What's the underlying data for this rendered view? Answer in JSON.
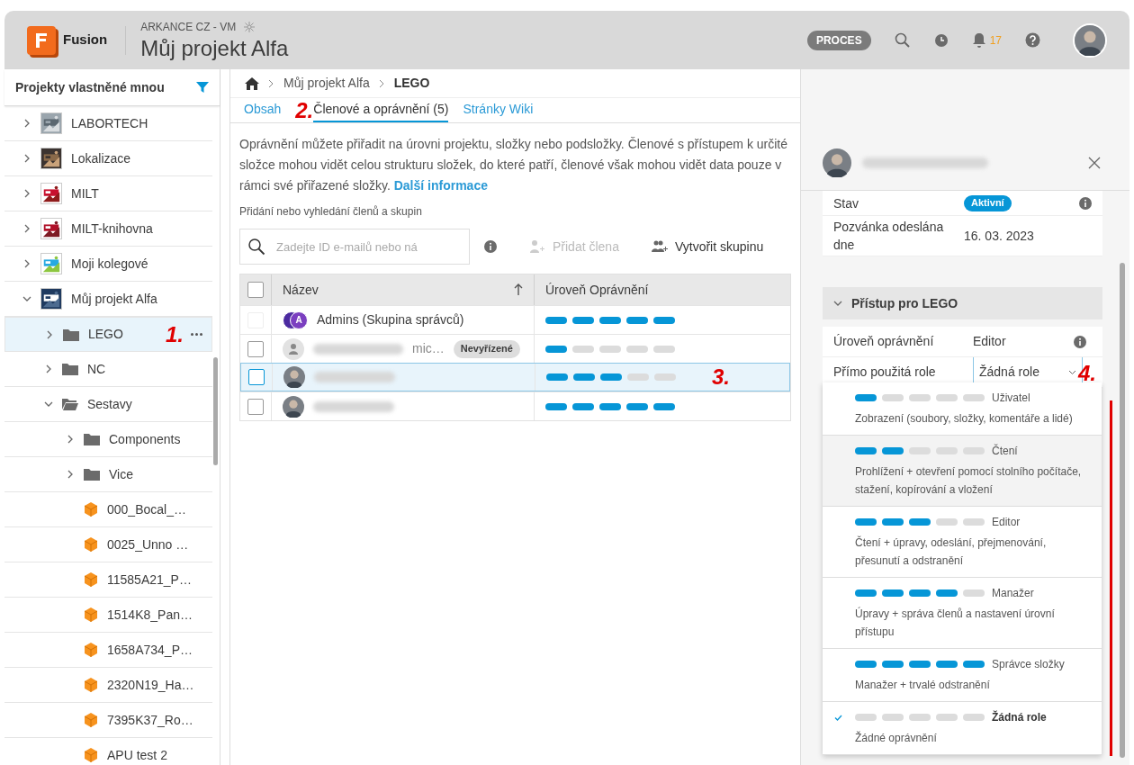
{
  "header": {
    "brand": "Fusion",
    "hub": "ARKANCE CZ - VM",
    "project_title": "Můj projekt Alfa",
    "process_badge": "PROCES",
    "notification_count": "17"
  },
  "sidebar": {
    "title": "Projekty vlastněné mnou",
    "tree": [
      {
        "kind": "project",
        "label": "LABORTECH",
        "expanded": false,
        "selected": false
      },
      {
        "kind": "project",
        "label": "Lokalizace",
        "expanded": false,
        "selected": false
      },
      {
        "kind": "project",
        "label": "MILT",
        "expanded": false,
        "selected": false
      },
      {
        "kind": "project",
        "label": "MILT-knihovna",
        "expanded": false,
        "selected": false
      },
      {
        "kind": "project",
        "label": "Moji kolegové",
        "expanded": false,
        "selected": false
      },
      {
        "kind": "project",
        "label": "Můj projekt Alfa",
        "expanded": true,
        "selected": false,
        "children": [
          {
            "kind": "folder",
            "label": "LEGO",
            "expanded": false,
            "selected": true
          },
          {
            "kind": "folder",
            "label": "NC",
            "expanded": false,
            "selected": false
          },
          {
            "kind": "folder",
            "label": "Sestavy",
            "expanded": true,
            "selected": false,
            "children": [
              {
                "kind": "folder",
                "label": "Components",
                "expanded": false,
                "selected": false
              },
              {
                "kind": "folder",
                "label": "Vice",
                "expanded": false,
                "selected": false
              },
              {
                "kind": "file",
                "label": "000_Bocal_…",
                "selected": false
              },
              {
                "kind": "file",
                "label": "0025_Unno …",
                "selected": false
              },
              {
                "kind": "file",
                "label": "11585A21_P…",
                "selected": false
              },
              {
                "kind": "file",
                "label": "1514K8_Pan…",
                "selected": false
              },
              {
                "kind": "file",
                "label": "1658A734_P…",
                "selected": false
              },
              {
                "kind": "file",
                "label": "2320N19_Ha…",
                "selected": false
              },
              {
                "kind": "file",
                "label": "7395K37_Ro…",
                "selected": false
              },
              {
                "kind": "file",
                "label": "APU test 2",
                "selected": false
              }
            ]
          }
        ]
      }
    ]
  },
  "breadcrumb": [
    "Můj projekt Alfa",
    "LEGO"
  ],
  "tabs": [
    {
      "label": "Obsah",
      "selected": false
    },
    {
      "label": "Členové a oprávnění (5)",
      "selected": true
    },
    {
      "label": "Stránky Wiki",
      "selected": false
    }
  ],
  "intro": {
    "text": "Oprávnění můžete přiřadit na úrovni projektu, složky nebo podsložky. Členové s přístupem k určité složce mohou vidět celou strukturu složek, do které patří, členové však mohou vidět data pouze v rámci své přiřazené složky.",
    "link": "Další informace"
  },
  "search": {
    "label": "Přidání nebo vyhledání členů a skupin",
    "placeholder": "Zadejte ID e-mailů nebo ná"
  },
  "actions": [
    {
      "kind": "add_member",
      "label": "Přidat člena",
      "disabled": true
    },
    {
      "kind": "create_group",
      "label": "Vytvořit skupinu",
      "disabled": false
    }
  ],
  "table": {
    "columns": [
      "Název",
      "Úroveň Oprávnění"
    ],
    "all_selected": false,
    "rows": [
      {
        "kind": "group",
        "avatar_letter": "A",
        "name": "Admins (Skupina správců)",
        "stars": 5,
        "selected": false,
        "checkbox_disabled": true
      },
      {
        "kind": "pending",
        "email": "mic…",
        "badge": "Nevyřízené",
        "stars": 1,
        "selected": false
      },
      {
        "kind": "user",
        "stars": 3,
        "selected": true
      },
      {
        "kind": "user",
        "stars": 5,
        "selected": false
      }
    ]
  },
  "panel": {
    "fields": [
      {
        "kind": "badge",
        "label": "Stav",
        "value": "Aktivní"
      },
      {
        "kind": "text",
        "label": "Pozvánka odeslána dne",
        "value": "16. 03. 2023"
      }
    ],
    "section": {
      "title": "Přístup pro LEGO",
      "expanded": true,
      "rows": [
        {
          "kind": "text",
          "label": "Úroveň oprávnění",
          "value": "Editor"
        },
        {
          "kind": "select",
          "label": "Přímo použitá role",
          "value": "Žádná role"
        }
      ]
    },
    "role_menu": [
      {
        "name": "Uživatel",
        "description": "Zobrazení (soubory, složky, komentáře a lidé)",
        "stars": 1,
        "selected": false,
        "hovered": false
      },
      {
        "name": "Čtení",
        "description": "Prohlížení + otevření pomocí stolního počítače, stažení, kopírování a vložení",
        "stars": 2,
        "selected": false,
        "hovered": true
      },
      {
        "name": "Editor",
        "description": "Čtení + úpravy, odeslání, přejmenování, přesunutí a odstranění",
        "stars": 3,
        "selected": false,
        "hovered": false
      },
      {
        "name": "Manažer",
        "description": "Úpravy + správa členů a nastavení úrovní přístupu",
        "stars": 4,
        "selected": false,
        "hovered": false
      },
      {
        "name": "Správce složky",
        "description": "Manažer + trvalé odstranění",
        "stars": 5,
        "selected": false,
        "hovered": false
      },
      {
        "name": "Žádná role",
        "description": "Žádné oprávnění",
        "stars": 0,
        "selected": true,
        "hovered": false
      }
    ]
  },
  "annotations": [
    "1.",
    "2.",
    "3.",
    "4."
  ]
}
